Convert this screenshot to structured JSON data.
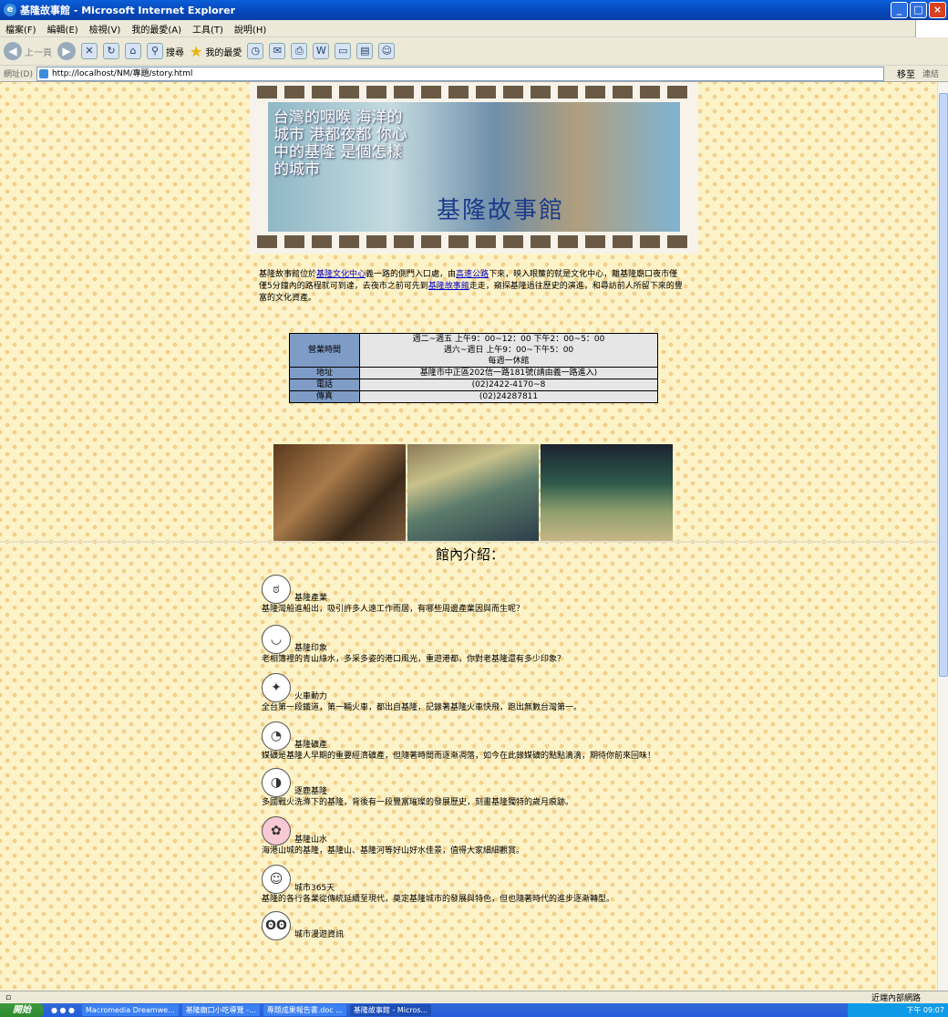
{
  "window": {
    "title": "基隆故事館 - Microsoft Internet Explorer"
  },
  "menu": [
    "檔案(F)",
    "編輯(E)",
    "檢視(V)",
    "我的最愛(A)",
    "工具(T)",
    "說明(H)"
  ],
  "toolbar": {
    "back": "上一頁",
    "search": "搜尋",
    "favorites": "我的最愛"
  },
  "address": {
    "label": "網址(D)",
    "url": "http://localhost/NM/專題/story.html",
    "go": "移至",
    "links": "連結"
  },
  "banner": {
    "lines": "台灣的咽喉 海洋的城市 港都夜都 你心中的基隆 是個怎樣的城市",
    "name": "基隆故事館"
  },
  "intro": {
    "p1": "基隆故事館位於",
    "link1": "基隆文化中心",
    "p2": "義一路的側門入口處，由",
    "link2": "高速公路",
    "p3": "下來，映入眼簾的就是文化中心，離基隆廟口夜市僅僅5分鐘內的路程就可到達，去夜市之前可先到",
    "link3": "基隆故事館",
    "p4": "走走，窺探基隆過往歷史的演進，和尋訪前人所留下來的豐富的文化資產。"
  },
  "info": {
    "hours_label": "營業時間",
    "hours1": "週二~週五 上午9：00~12：00 下午2：00~5：00",
    "hours2": "週六~週日 上午9：00~下午5：00",
    "hours3": "每週一休館",
    "addr_label": "地址",
    "addr": "基隆市中正區202信一路181號(請由義一路進入)",
    "tel_label": "電話",
    "tel": "(02)2422-4170~8",
    "fax_label": "傳真",
    "fax": "(02)24287811"
  },
  "hall_title": "館內介紹：",
  "items": [
    {
      "name": "基隆產業",
      "desc": "基隆灣船進船出，吸引許多人遠工作而居，有哪些周邊產業因與而生呢？"
    },
    {
      "name": "基隆印象",
      "desc": "老相簿裡的青山綠水，多采多姿的港口風光，重遊港都，你對老基隆還有多少印象？"
    },
    {
      "name": "火車動力",
      "desc": "全台第一段鐵道，第一輛火車，都出自基隆，記錄著基隆火車快飛，跑出無數台灣第一。"
    },
    {
      "name": "基隆礦產",
      "desc": "媒礦是基隆人早期的重要經濟礦產，但隨著時間而逐漸凋落，如今在此錄媒礦的點點滴滴，期待你前來回味！"
    },
    {
      "name": "逐鹿基隆",
      "desc": "多國戰火洗滌下的基隆，背後有一段豐富璀璨的發展歷史，刻畫基隆獨特的歲月痕跡。"
    },
    {
      "name": "基隆山水",
      "desc": "海港山城的基隆，基隆山、基隆河等好山好水佳景，值得大家細細觀賞。"
    },
    {
      "name": "城市365天",
      "desc": "基隆的各行各業從傳統延續至現代，奠定基隆城市的發展與特色，但也隨著時代的進步逐漸轉型。"
    },
    {
      "name": "城市漫遊資訊",
      "desc": ""
    }
  ],
  "status": {
    "zone": "近端內部網路"
  },
  "taskbar": {
    "start": "開始",
    "tasks": [
      "Macromedia Dreamwe...",
      "基隆廟口小吃導覽 -...",
      "專題成果報告書.doc ...",
      "基隆故事館 - Micros..."
    ],
    "clock": "下午 09:07"
  }
}
